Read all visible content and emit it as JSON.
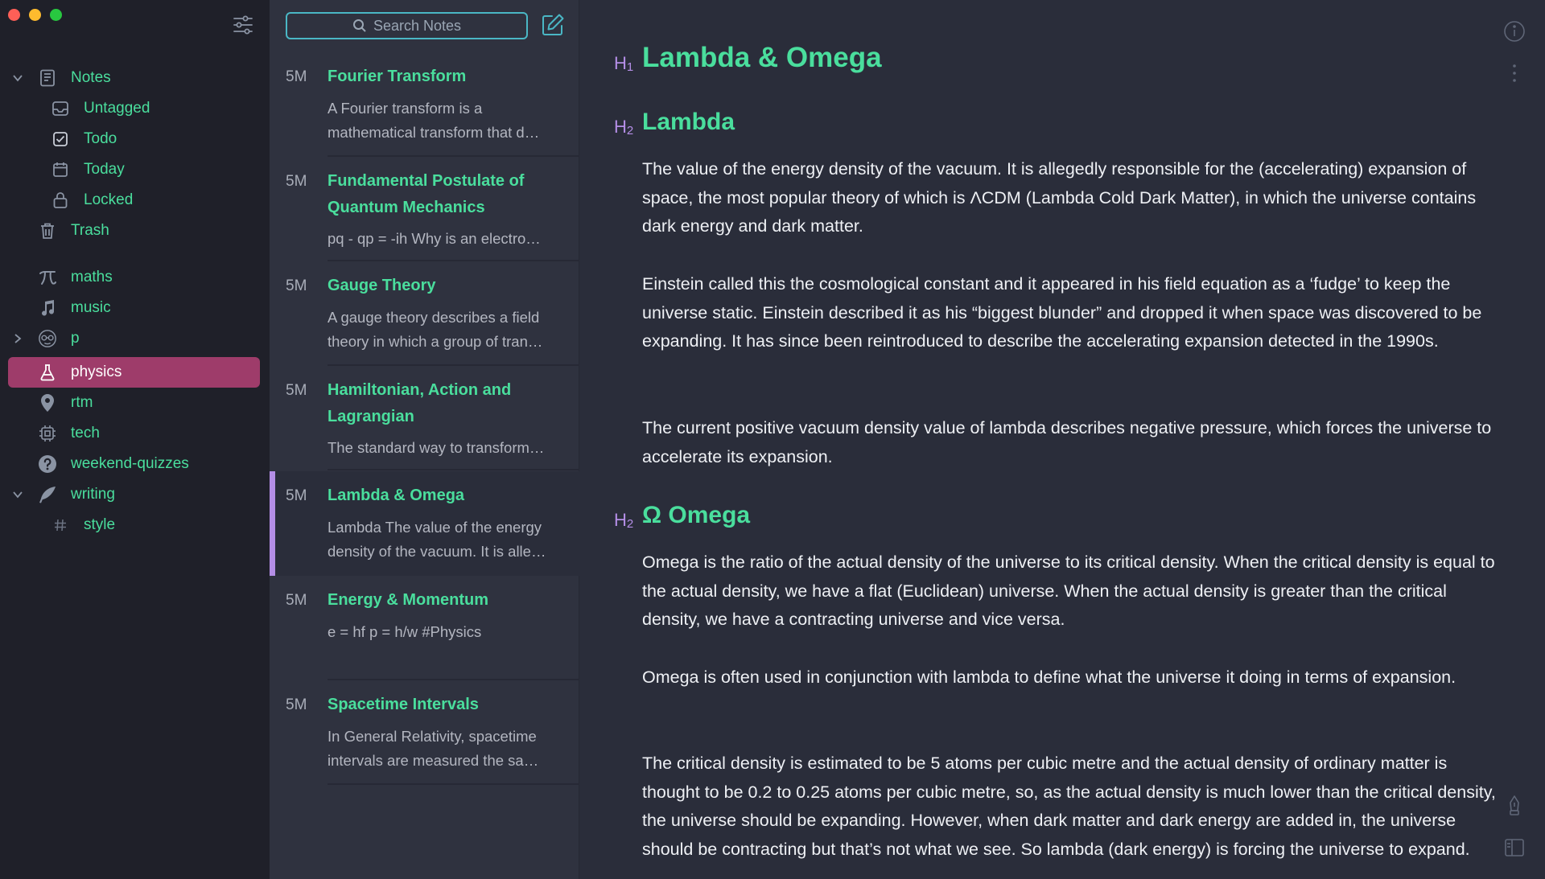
{
  "sidebar": {
    "items": [
      {
        "label": "Notes",
        "icon": "note-icon"
      },
      {
        "label": "Untagged",
        "icon": "inbox-icon"
      },
      {
        "label": "Todo",
        "icon": "checkbox-icon"
      },
      {
        "label": "Today",
        "icon": "calendar-icon"
      },
      {
        "label": "Locked",
        "icon": "lock-icon"
      },
      {
        "label": "Trash",
        "icon": "trash-icon"
      },
      {
        "label": "maths",
        "icon": "pi-icon"
      },
      {
        "label": "music",
        "icon": "music-note-icon"
      },
      {
        "label": "p",
        "icon": "face-icon"
      },
      {
        "label": "physics",
        "icon": "flask-icon"
      },
      {
        "label": "rtm",
        "icon": "map-pin-icon"
      },
      {
        "label": "tech",
        "icon": "chip-icon"
      },
      {
        "label": "weekend-quizzes",
        "icon": "question-icon"
      },
      {
        "label": "writing",
        "icon": "feather-icon"
      },
      {
        "label": "style",
        "icon": "hashtag-icon"
      }
    ]
  },
  "notelist": {
    "search_placeholder": "Search Notes",
    "notes": [
      {
        "age": "5M",
        "title": "Fourier Transform",
        "preview1": "A Fourier transform is a",
        "preview2": "mathematical transform that d…"
      },
      {
        "age": "5M",
        "title": "Fundamental Postulate of",
        "title2": "Quantum Mechanics",
        "preview1": "pq - qp = -ih Why is an electro…"
      },
      {
        "age": "5M",
        "title": "Gauge Theory",
        "preview1": "A gauge theory describes a field",
        "preview2": "theory in which a group of tran…"
      },
      {
        "age": "5M",
        "title": "Hamiltonian, Action and",
        "title2": "Lagrangian",
        "preview1": "The standard way to transform…"
      },
      {
        "age": "5M",
        "title": "Lambda & Omega",
        "preview1": "Lambda The value of the energy",
        "preview2": "density of the vacuum. It is alle…"
      },
      {
        "age": "5M",
        "title": "Energy & Momentum",
        "preview1": "e = hf p = h/w #Physics"
      },
      {
        "age": "5M",
        "title": "Spacetime Intervals",
        "preview1": "In General Relativity, spacetime",
        "preview2": "intervals are measured the sa…"
      }
    ]
  },
  "editor": {
    "h1_mark": "H",
    "h1_sub": "1",
    "h2_mark": "H",
    "h2_sub": "2",
    "title": "Lambda & Omega",
    "section1": "Lambda",
    "section2": "Ω Omega",
    "paragraphs": [
      "The value of the energy density of the vacuum. It is allegedly responsible for the (accelerating) expansion of space, the most popular theory of which is ΛCDM (Lambda Cold Dark Matter), in which the universe contains dark energy and dark matter.",
      "Einstein called this the cosmological constant and it appeared in his field equation as a ‘fudge’ to keep the universe static. Einstein described it as his “biggest blunder” and dropped it when space was discovered to be expanding. It has since been reintroduced to describe the accelerating expansion detected in the 1990s.",
      "The current positive vacuum density value of lambda describes negative pressure, which forces the universe to accelerate its expansion.",
      "Omega is the ratio of the actual density of the universe to its critical density. When the critical density is equal to the actual density, we have a flat (Euclidean) universe. When the actual density is greater than the critical density, we have a contracting universe and vice versa.",
      "Omega is often used in conjunction with lambda to define what the universe it doing in terms of expansion.",
      "The critical density is estimated to be 5 atoms per cubic metre and the actual density of ordinary matter is thought to be 0.2 to 0.25 atoms per cubic metre, so, as the actual density is much lower than the critical density, the universe should be expanding. However, when dark matter and dark energy are added in, the universe should be contracting but that’s not what we see. So lambda (dark energy) is forcing the universe to expand."
    ]
  },
  "colors": {
    "accent_green": "#4ade9d",
    "accent_purple": "#b48ee6",
    "active_tag": "#9e3c6a",
    "search_border": "#4ab7c5"
  }
}
